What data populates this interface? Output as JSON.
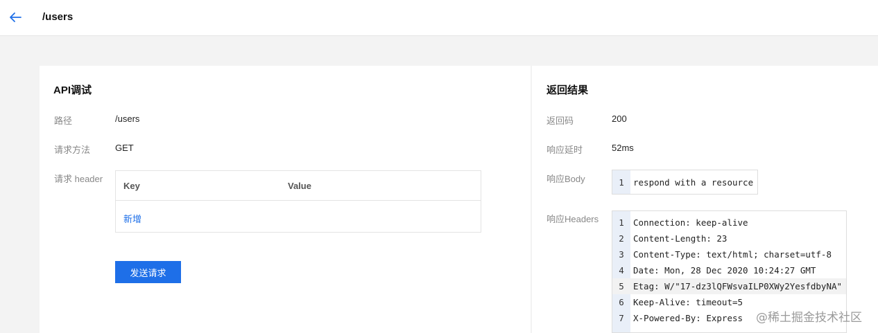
{
  "header": {
    "title": "/users"
  },
  "left": {
    "title": "API调试",
    "path_label": "路径",
    "path_value": "/users",
    "method_label": "请求方法",
    "method_value": "GET",
    "header_label": "请求 header",
    "table": {
      "key_col": "Key",
      "value_col": "Value",
      "add_label": "新增"
    },
    "send_label": "发送请求"
  },
  "right": {
    "title": "返回结果",
    "code_label": "返回码",
    "code_value": "200",
    "latency_label": "响应延时",
    "latency_value": "52ms",
    "body_label": "响应Body",
    "body_lines": [
      {
        "num": "1",
        "text": "respond with a resource"
      }
    ],
    "headers_label": "响应Headers",
    "header_lines": [
      {
        "num": "1",
        "text": "Connection: keep-alive"
      },
      {
        "num": "2",
        "text": "Content-Length: 23"
      },
      {
        "num": "3",
        "text": "Content-Type: text/html; charset=utf-8"
      },
      {
        "num": "4",
        "text": "Date: Mon, 28 Dec 2020 10:24:27 GMT"
      },
      {
        "num": "5",
        "text": "Etag: W/\"17-dz3lQFWsvaILP0XWy2YesfdbyNA\""
      },
      {
        "num": "6",
        "text": "Keep-Alive: timeout=5"
      },
      {
        "num": "7",
        "text": "X-Powered-By: Express"
      }
    ]
  },
  "watermark": "@稀土掘金技术社区",
  "colors": {
    "accent": "#1e6fe8",
    "gutter": "#e9eff8"
  },
  "icons": {
    "back": "arrow-left-icon"
  }
}
